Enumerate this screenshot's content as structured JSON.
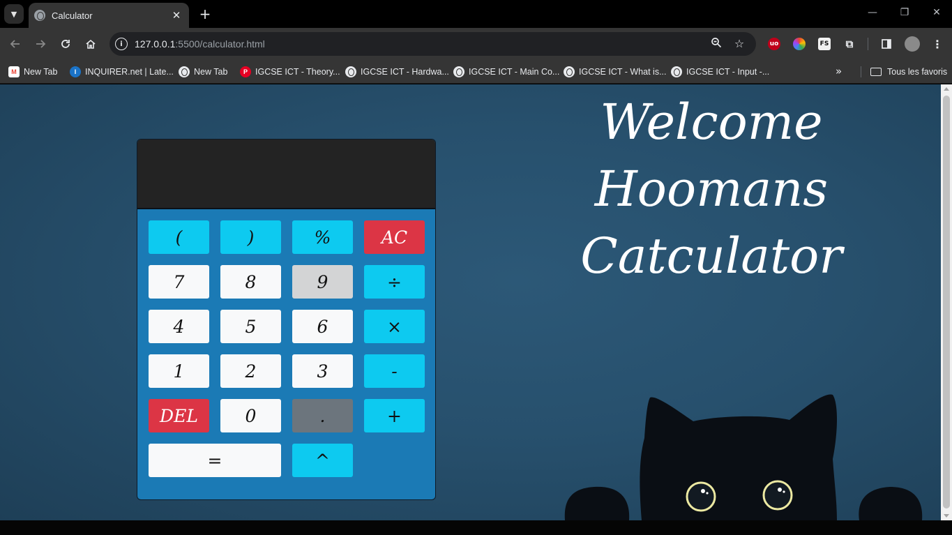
{
  "browser": {
    "tab_title": "Calculator",
    "tab_close": "✕",
    "new_tab": "+",
    "url_host": "127.0.0.1",
    "url_rest": ":5500/calculator.html",
    "window_controls": {
      "minimize": "—",
      "restore": "❐",
      "close": "✕"
    }
  },
  "bookmarks": {
    "items": [
      {
        "label": "New Tab",
        "icon": "gmail-icon"
      },
      {
        "label": "INQUIRER.net | Late...",
        "icon": "inquirer-icon"
      },
      {
        "label": "New Tab",
        "icon": "globe-icon"
      },
      {
        "label": "IGCSE ICT - Theory...",
        "icon": "pinterest-icon"
      },
      {
        "label": "IGCSE ICT - Hardwa...",
        "icon": "globe-icon"
      },
      {
        "label": "IGCSE ICT - Main Co...",
        "icon": "globe-icon"
      },
      {
        "label": "IGCSE ICT - What is...",
        "icon": "globe-icon"
      },
      {
        "label": "IGCSE ICT - Input -...",
        "icon": "globe-icon"
      }
    ],
    "more": "»",
    "all_bookmarks": "Tous les favoris"
  },
  "page": {
    "welcome_lines": [
      "Welcome",
      "Hoomans",
      "Catculator"
    ],
    "display_value": "",
    "keys": [
      {
        "label": "(",
        "style": "cyan"
      },
      {
        "label": ")",
        "style": "cyan"
      },
      {
        "label": "%",
        "style": "cyan"
      },
      {
        "label": "AC",
        "style": "red"
      },
      {
        "label": "7",
        "style": "white"
      },
      {
        "label": "8",
        "style": "white"
      },
      {
        "label": "9",
        "style": "lightgray"
      },
      {
        "label": "÷",
        "style": "cyan"
      },
      {
        "label": "4",
        "style": "white"
      },
      {
        "label": "5",
        "style": "white"
      },
      {
        "label": "6",
        "style": "white"
      },
      {
        "label": "×",
        "style": "cyan"
      },
      {
        "label": "1",
        "style": "white"
      },
      {
        "label": "2",
        "style": "white"
      },
      {
        "label": "3",
        "style": "white"
      },
      {
        "label": "-",
        "style": "cyan"
      },
      {
        "label": "DEL",
        "style": "red"
      },
      {
        "label": "0",
        "style": "white"
      },
      {
        "label": ".",
        "style": "gray"
      },
      {
        "label": "+",
        "style": "cyan"
      },
      {
        "label": "=",
        "style": "white wide"
      },
      {
        "label": "^",
        "style": "cyan"
      }
    ]
  },
  "colors": {
    "background": "#27506d",
    "calculator_body": "#1b7ab5",
    "display": "#232323",
    "key_cyan": "#0dcaf0",
    "key_red": "#dc3545",
    "key_white": "#f8f9fa",
    "key_gray": "#6c757d"
  }
}
